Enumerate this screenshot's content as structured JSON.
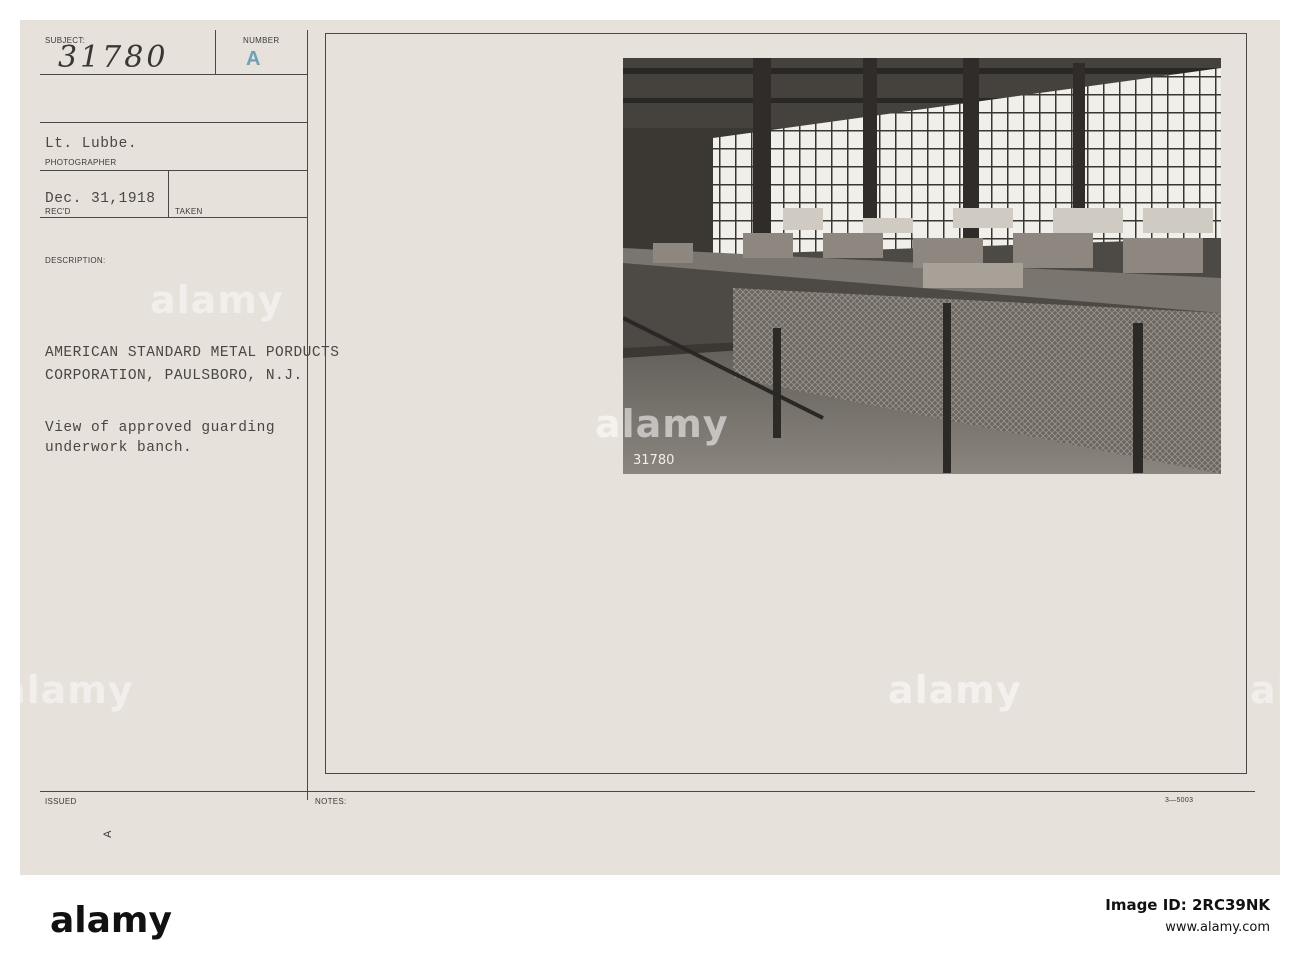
{
  "card": {
    "subject_label": "SUBJECT:",
    "subject_number": "31780",
    "number_label": "NUMBER",
    "number_value": "A",
    "photographer_name": "Lt. Lubbe.",
    "photographer_label": "PHOTOGRAPHER",
    "date_value": "Dec. 31,1918",
    "recd_label": "REC'D",
    "taken_label": "TAKEN",
    "description_label": "DESCRIPTION:",
    "description_lines": [
      "AMERICAN STANDARD METAL PORDUCTS",
      "CORPORATION, PAULSBORO, N.J."
    ],
    "caption_lines": [
      "View of approved guarding",
      "underwork banch."
    ],
    "issued_label": "ISSUED",
    "issued_mark": "A",
    "notes_label": "NOTES:",
    "form_code": "3—5003"
  },
  "photo": {
    "print_number": "31780",
    "depiction": "factory interior with machines on long workbench and wire mesh guards"
  },
  "watermark": {
    "text": "alamy"
  },
  "stock_bar": {
    "logo": "alamy",
    "image_id": "Image ID: 2RC39NK",
    "url": "www.alamy.com"
  },
  "colors": {
    "card": "#e6e1da",
    "ink": "#4a4642",
    "stamp": "#6fa0b5"
  }
}
